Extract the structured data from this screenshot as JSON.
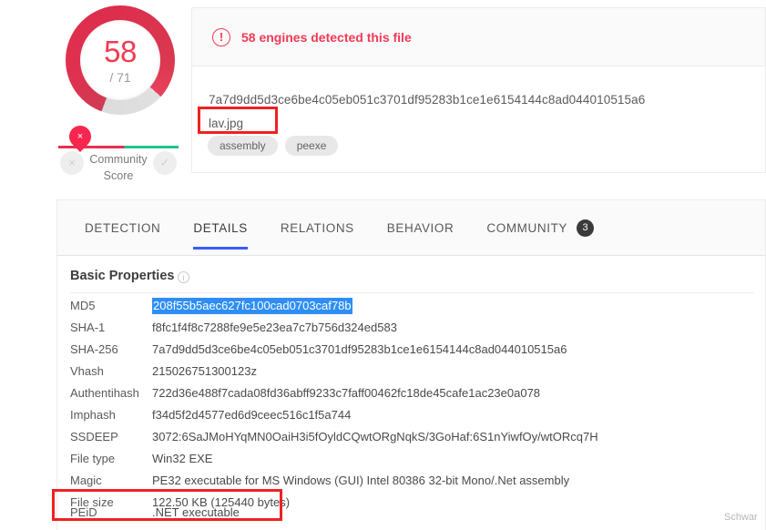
{
  "detection": {
    "score": "58",
    "total": "/ 71",
    "alert_icon": "exclamation-circle-icon",
    "alert_text": "58 engines detected this file"
  },
  "community": {
    "label_line1": "Community",
    "label_line2": "Score",
    "pin_glyph": "×",
    "downvote_glyph": "×",
    "upvote_glyph": "✓"
  },
  "file": {
    "hash": "7a7d9dd5d3ce6be4c05eb051c3701df95283b1ce1e6154144c8ad044010515a6",
    "name": "lav.jpg",
    "tags": [
      "assembly",
      "peexe"
    ]
  },
  "tabs": [
    {
      "label": "DETECTION",
      "active": false
    },
    {
      "label": "DETAILS",
      "active": true
    },
    {
      "label": "RELATIONS",
      "active": false
    },
    {
      "label": "BEHAVIOR",
      "active": false
    },
    {
      "label": "COMMUNITY",
      "active": false,
      "badge": "3"
    }
  ],
  "basic_properties": {
    "title": "Basic Properties",
    "info_glyph": "i",
    "rows": [
      {
        "key": "MD5",
        "value": "208f55b5aec627fc100cad0703caf78b",
        "selected": true
      },
      {
        "key": "SHA-1",
        "value": "f8fc1f4f8c7288fe9e5e23ea7c7b756d324ed583"
      },
      {
        "key": "SHA-256",
        "value": "7a7d9dd5d3ce6be4c05eb051c3701df95283b1ce1e6154144c8ad044010515a6"
      },
      {
        "key": "Vhash",
        "value": "215026751300123z"
      },
      {
        "key": "Authentihash",
        "value": "722d36e488f7cada08fd36abff9233c7faff00462fc18de45cafe1ac23e0a078"
      },
      {
        "key": "Imphash",
        "value": "f34d5f2d4577ed6d9ceec516c1f5a744"
      },
      {
        "key": "SSDEEP",
        "value": "3072:6SaJMoHYqMN0OaiH3i5fOyldCQwtORgNqkS/3GoHaf:6S1nYiwfOy/wtORcq7H"
      },
      {
        "key": "File type",
        "value": "Win32 EXE"
      },
      {
        "key": "Magic",
        "value": "PE32 executable for MS Windows (GUI) Intel 80386 32-bit Mono/.Net assembly"
      },
      {
        "key": "File size",
        "value": "122.50 KB (125440 bytes)"
      },
      {
        "key": "PEiD",
        "value": ".NET executable"
      }
    ]
  },
  "annotations": {
    "filename_box_color": "#ee2222",
    "peid_box_color": "#ee2222"
  },
  "watermark": "Schwar"
}
